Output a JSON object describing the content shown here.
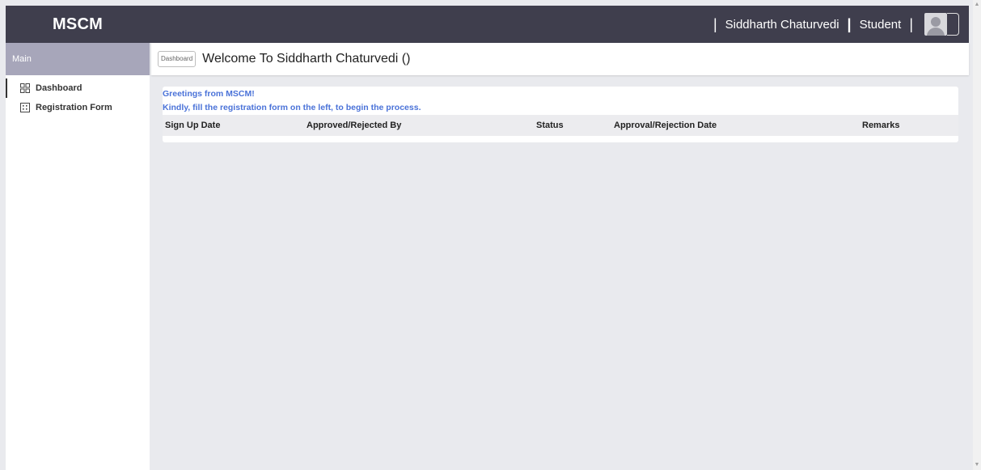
{
  "header": {
    "brand": "MSCM",
    "user_name": "Siddharth Chaturvedi",
    "role": "Student",
    "separator": "|"
  },
  "sidebar": {
    "section_title": "Main",
    "items": [
      {
        "label": "Dashboard",
        "icon": "grid-icon"
      },
      {
        "label": "Registration Form",
        "icon": "form-icon"
      }
    ]
  },
  "page": {
    "breadcrumb": "Dashboard",
    "title": "Welcome To Siddharth Chaturvedi ()"
  },
  "content": {
    "greeting": "Greetings from MSCM!",
    "instruction": "Kindly, fill the registration form on the left, to begin the process.",
    "table": {
      "columns": [
        "Sign Up Date",
        "Approved/Rejected By",
        "Status",
        "Approval/Rejection Date",
        "Remarks"
      ],
      "rows": []
    }
  },
  "colors": {
    "topbar": "#3f3e4d",
    "sidebar_header": "#a7a6ba",
    "accent_text": "#4a72d8",
    "background": "#e9eaee"
  }
}
